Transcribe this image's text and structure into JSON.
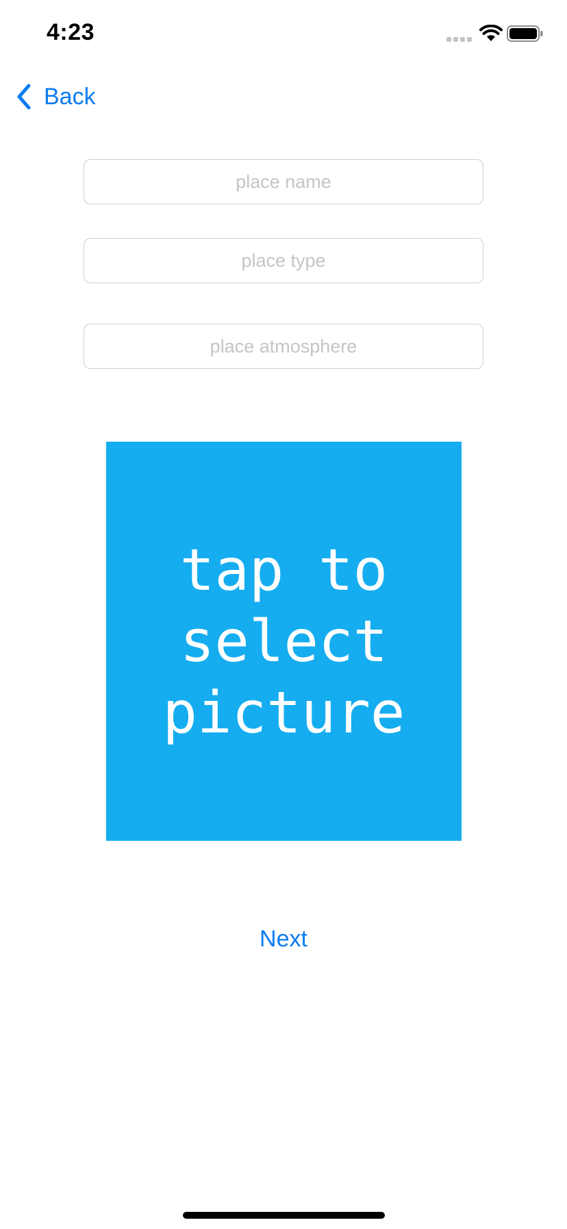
{
  "status_bar": {
    "time": "4:23",
    "icons": [
      "signal-icon",
      "wifi-icon",
      "battery-icon"
    ]
  },
  "nav": {
    "back_label": "Back",
    "back_icon": "chevron-left-icon"
  },
  "form": {
    "fields": [
      {
        "value": "",
        "placeholder": "place name"
      },
      {
        "value": "",
        "placeholder": "place type"
      },
      {
        "value": "",
        "placeholder": "place atmosphere"
      }
    ]
  },
  "picture": {
    "label": "tap to\nselect\npicture",
    "background": "#15adf0"
  },
  "actions": {
    "next_label": "Next"
  },
  "colors": {
    "accent": "#0a7cf2",
    "tile": "#15adf0"
  }
}
